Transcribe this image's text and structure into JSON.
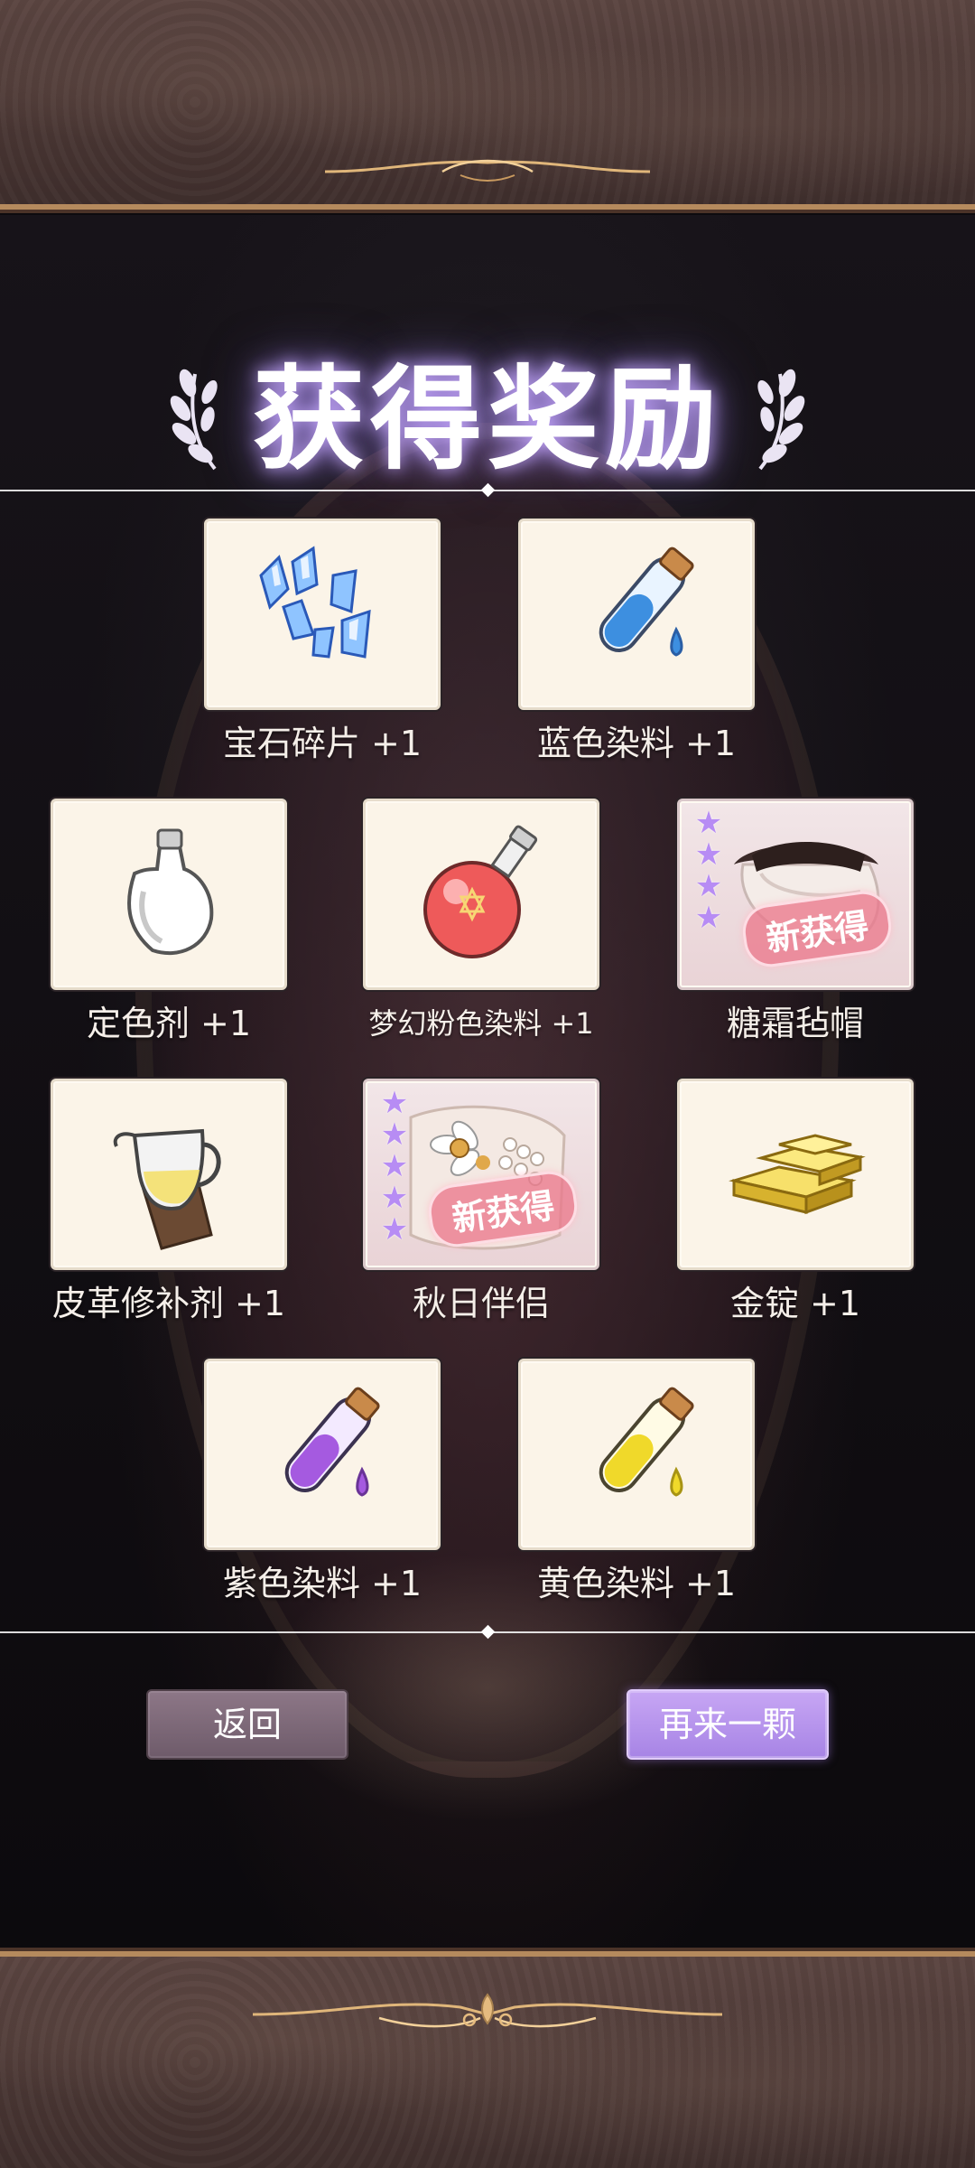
{
  "title": "获得奖励",
  "rewards": [
    {
      "name": "宝石碎片 +1",
      "icon": "gem-shards-icon",
      "rare": false
    },
    {
      "name": "蓝色染料 +1",
      "icon": "blue-dye-vial-icon",
      "rare": false
    },
    {
      "name": "定色剂 +1",
      "icon": "fixative-bottle-icon",
      "rare": false
    },
    {
      "name": "梦幻粉色染料 +1",
      "icon": "pink-potion-icon",
      "rare": false
    },
    {
      "name": "糖霜毡帽",
      "icon": "felt-hat-icon",
      "rare": true,
      "stars": 4,
      "badge": "新获得"
    },
    {
      "name": "皮革修补剂 +1",
      "icon": "leather-repair-pitcher-icon",
      "rare": false
    },
    {
      "name": "秋日伴侣",
      "icon": "autumn-companion-icon",
      "rare": true,
      "stars": 5,
      "badge": "新获得"
    },
    {
      "name": "金锭 +1",
      "icon": "gold-ingot-icon",
      "rare": false
    },
    {
      "name": "紫色染料 +1",
      "icon": "purple-dye-vial-icon",
      "rare": false
    },
    {
      "name": "黄色染料 +1",
      "icon": "yellow-dye-vial-icon",
      "rare": false
    }
  ],
  "buttons": {
    "back": "返回",
    "again": "再来一颗"
  },
  "colors": {
    "accent_purple": "#b78cf4",
    "frame_gold": "#b58a5d",
    "card_bg": "#fbf4e8"
  }
}
